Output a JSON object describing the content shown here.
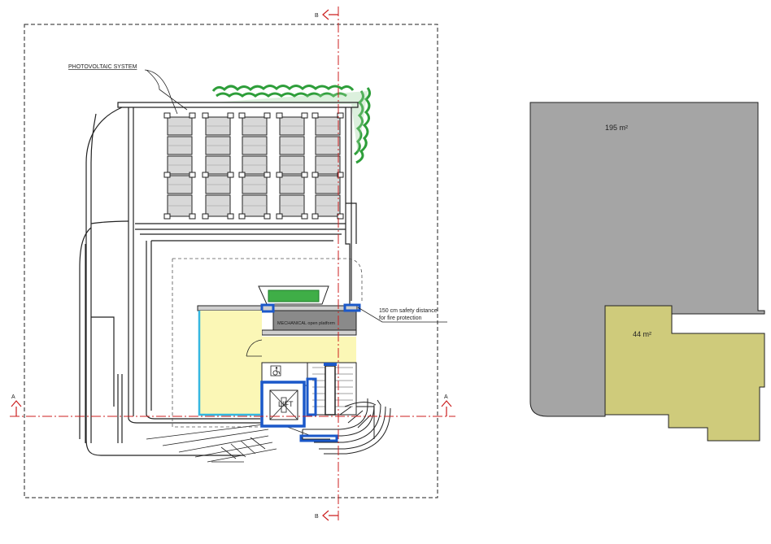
{
  "plan": {
    "labels": {
      "photovoltaic": "PHOTOVOLTAIC SYSTEM",
      "mechanical": "MECHANICAL open platform",
      "lift": "LIFT",
      "safety_line1": "150 cm safety distance",
      "safety_line2": "for fire protection"
    },
    "section_marks": {
      "a_left": "A",
      "a_right": "A",
      "b_top": "B",
      "b_bottom": "B"
    }
  },
  "areas": {
    "large_area": "195 m²",
    "small_area": "44 m²"
  },
  "colors": {
    "section_line": "#cc1f1f",
    "vegetation": "#2e9e3a",
    "terrace_fill": "#fbf7b6",
    "blue_outline": "#1b58c9",
    "cyan_outline": "#35b7e0",
    "area_gray": "#a5a5a5",
    "area_olive": "#cfcb7b"
  }
}
